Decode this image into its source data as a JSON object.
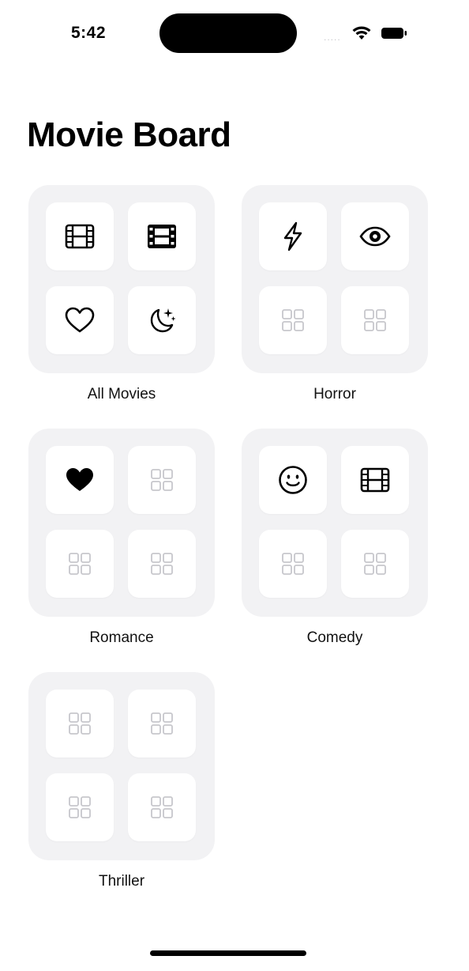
{
  "status_bar": {
    "time": "5:42",
    "signal": "....."
  },
  "header": {
    "title": "Movie Board"
  },
  "boards": [
    {
      "label": "All Movies",
      "tiles": [
        "film-icon",
        "film-filled-icon",
        "heart-outline-icon",
        "moon-stars-icon"
      ]
    },
    {
      "label": "Horror",
      "tiles": [
        "bolt-icon",
        "eye-icon",
        "placeholder-icon",
        "placeholder-icon"
      ]
    },
    {
      "label": "Romance",
      "tiles": [
        "heart-filled-icon",
        "placeholder-icon",
        "placeholder-icon",
        "placeholder-icon"
      ]
    },
    {
      "label": "Comedy",
      "tiles": [
        "smile-icon",
        "film-icon",
        "placeholder-icon",
        "placeholder-icon"
      ]
    },
    {
      "label": "Thriller",
      "tiles": [
        "placeholder-icon",
        "placeholder-icon",
        "placeholder-icon",
        "placeholder-icon"
      ]
    }
  ],
  "colors": {
    "card_background": "#f2f2f4",
    "tile_background": "#ffffff",
    "placeholder": "#c7c7cc",
    "text": "#000000"
  }
}
